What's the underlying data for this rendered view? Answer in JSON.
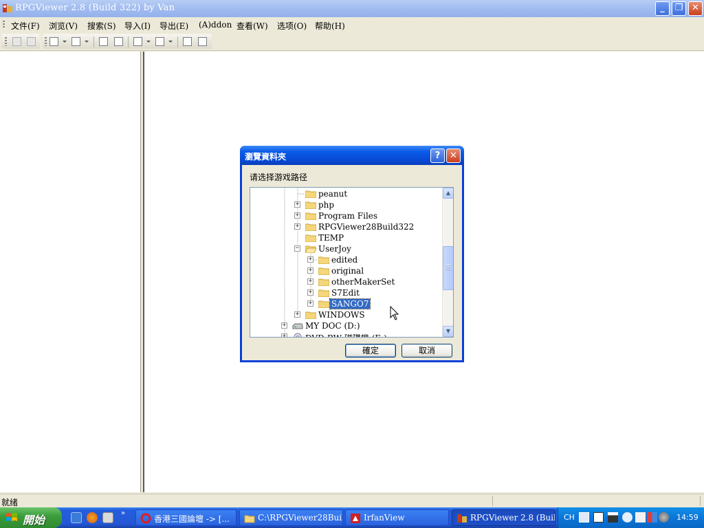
{
  "window": {
    "title": "RPGViewer 2.8 (Build 322) by Van",
    "minimize_label": "_",
    "restore_label": "❐",
    "close_label": "✕"
  },
  "menu": {
    "items": [
      "文件(F)",
      "浏览(V)",
      "搜索(S)",
      "导入(I)",
      "导出(E)",
      "(A)ddon",
      "查看(W)",
      "选项(O)",
      "帮助(H)"
    ]
  },
  "toolbar": {
    "icons": [
      "save-icon",
      "save-all-icon",
      "back-icon",
      "forward-icon",
      "cascade-icon",
      "tile-icon",
      "import-icon",
      "export-icon",
      "window1-icon",
      "window2-icon"
    ]
  },
  "statusbar": {
    "text": "就绪"
  },
  "dialog": {
    "title": "瀏覽資料夾",
    "help_label": "?",
    "close_label": "✕",
    "prompt": "请选择游戏路径",
    "tree": [
      {
        "label": "peanut",
        "expander": "",
        "selected": false
      },
      {
        "label": "php",
        "expander": "+",
        "selected": false
      },
      {
        "label": "Program Files",
        "expander": "+",
        "selected": false
      },
      {
        "label": "RPGViewer28Build322",
        "expander": "+",
        "selected": false
      },
      {
        "label": "TEMP",
        "expander": "",
        "selected": false
      },
      {
        "label": "UserJoy",
        "expander": "−",
        "selected": false
      },
      {
        "label": "edited",
        "expander": "+",
        "selected": false
      },
      {
        "label": "original",
        "expander": "+",
        "selected": false
      },
      {
        "label": "otherMakerSet",
        "expander": "+",
        "selected": false
      },
      {
        "label": "S7Edit",
        "expander": "+",
        "selected": false
      },
      {
        "label": "SANGO7",
        "expander": "+",
        "selected": true
      },
      {
        "label": "WINDOWS",
        "expander": "+",
        "selected": false
      },
      {
        "label": "MY DOC (D:)",
        "expander": "+",
        "selected": false
      },
      {
        "label": "DVD-RW 磁碟機 (E:)",
        "expander": "+",
        "selected": false
      }
    ],
    "scroll_up": "▲",
    "scroll_down": "▼",
    "ok_label": "確定",
    "cancel_label": "取消",
    "colors": {
      "title_blue": "#0a5ce8",
      "selection": "#316ac5"
    }
  },
  "taskbar": {
    "start_label": "開始",
    "quicklaunch_icons": [
      "ie-icon",
      "firefox-icon",
      "show-desktop-icon"
    ],
    "more_label": "»",
    "tasks": [
      {
        "label": "香港三國論壇 -> [...",
        "icon": "opera-icon",
        "active": false
      },
      {
        "label": "C:\\RPGViewer28Buil...",
        "icon": "folder-icon",
        "active": false
      },
      {
        "label": "IrfanView",
        "icon": "irfanview-icon",
        "active": false
      },
      {
        "label": "RPGViewer 2.8 (Buil...",
        "icon": "rpgviewer-icon",
        "active": true
      }
    ],
    "tray": {
      "lang": "CH",
      "clock": "14:59"
    }
  }
}
